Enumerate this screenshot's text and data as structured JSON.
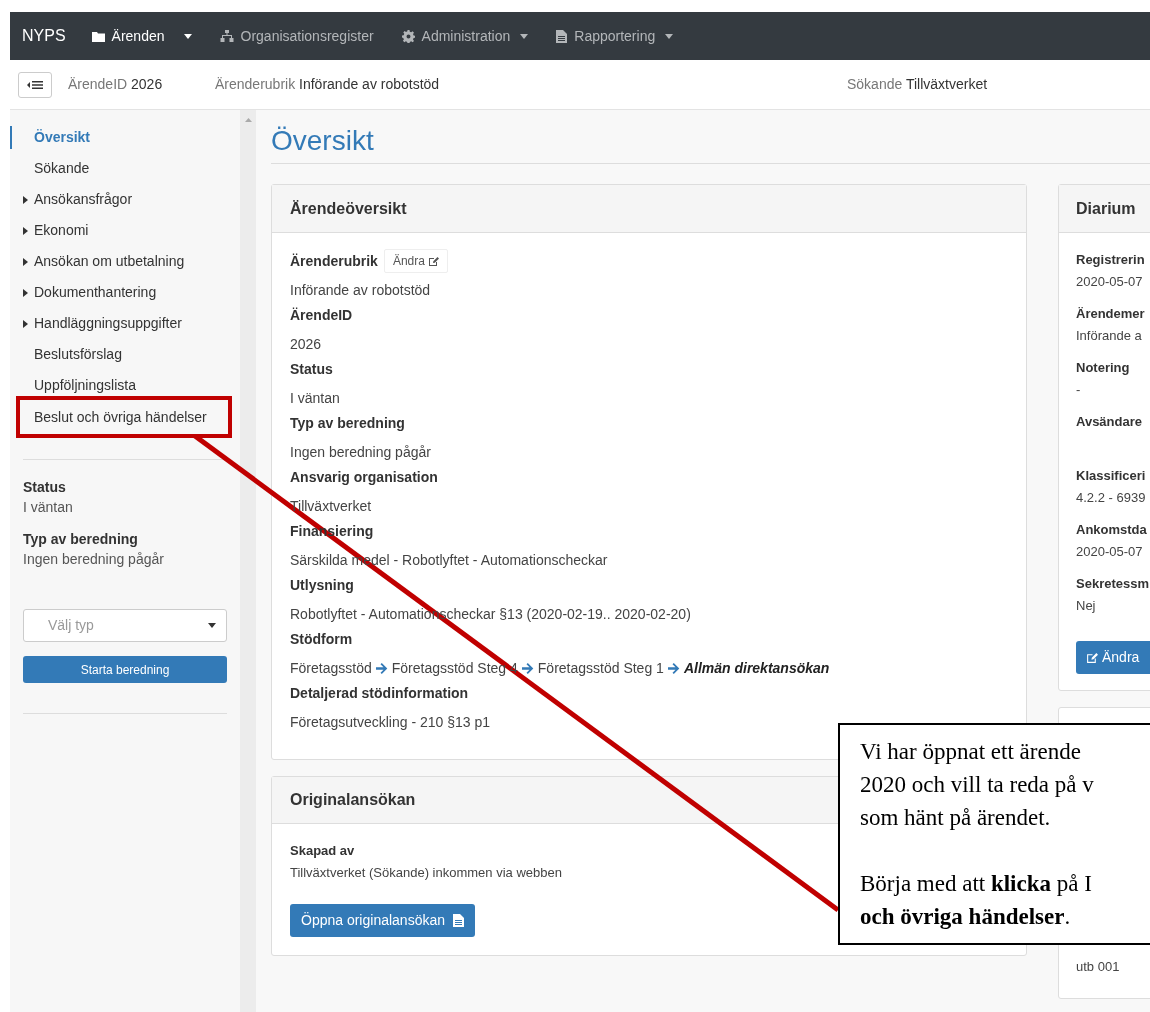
{
  "navbar": {
    "brand": "NYPS",
    "items": [
      {
        "label": "Ärenden",
        "dropdown": true,
        "active": true
      },
      {
        "label": "Organisationsregister",
        "dropdown": false,
        "active": false
      },
      {
        "label": "Administration",
        "dropdown": true,
        "active": false
      },
      {
        "label": "Rapportering",
        "dropdown": true,
        "active": false
      }
    ]
  },
  "case_header": [
    {
      "label": "ÄrendeID",
      "value": "2026"
    },
    {
      "label": "Ärenderubrik",
      "value": "Införande av robotstöd"
    },
    {
      "label": "Sökande",
      "value": "Tillväxtverket"
    }
  ],
  "sidebar": {
    "items": [
      {
        "label": "Översikt",
        "expandable": false,
        "selected": true,
        "highlighted": false
      },
      {
        "label": "Sökande",
        "expandable": false,
        "selected": false,
        "highlighted": false
      },
      {
        "label": "Ansökansfrågor",
        "expandable": true,
        "selected": false,
        "highlighted": false
      },
      {
        "label": "Ekonomi",
        "expandable": true,
        "selected": false,
        "highlighted": false
      },
      {
        "label": "Ansökan om utbetalning",
        "expandable": true,
        "selected": false,
        "highlighted": false
      },
      {
        "label": "Dokumenthantering",
        "expandable": true,
        "selected": false,
        "highlighted": false
      },
      {
        "label": "Handläggningsuppgifter",
        "expandable": true,
        "selected": false,
        "highlighted": false
      },
      {
        "label": "Beslutsförslag",
        "expandable": false,
        "selected": false,
        "highlighted": false
      },
      {
        "label": "Uppföljningslista",
        "expandable": false,
        "selected": false,
        "highlighted": false
      },
      {
        "label": "Beslut och övriga händelser",
        "expandable": false,
        "selected": false,
        "highlighted": true
      }
    ],
    "summary": [
      {
        "label": "Status",
        "value": "I väntan"
      },
      {
        "label": "Typ av beredning",
        "value": "Ingen beredning pågår"
      }
    ],
    "type_select": {
      "placeholder": "Välj typ"
    },
    "start_button": "Starta beredning"
  },
  "page_title": "Översikt",
  "overview_card": {
    "title": "Ärendeöversikt",
    "edit_button": "Ändra",
    "fields": [
      {
        "label": "Ärenderubrik",
        "value": "Införande av robotstöd",
        "editable": true
      },
      {
        "label": "ÄrendeID",
        "value": "2026",
        "editable": false
      },
      {
        "label": "Status",
        "value": "I väntan",
        "editable": false
      },
      {
        "label": "Typ av beredning",
        "value": "Ingen beredning pågår",
        "editable": false
      },
      {
        "label": "Ansvarig organisation",
        "value": "Tillväxtverket",
        "editable": false
      },
      {
        "label": "Finansiering",
        "value": "Särskilda medel - Robotlyftet - Automationscheckar",
        "editable": false
      },
      {
        "label": "Utlysning",
        "value": "Robotlyftet - Automationscheckar §13 (2020-02-19.. 2020-02-20)",
        "editable": false
      }
    ],
    "support_form": {
      "label": "Stödform",
      "steps": [
        {
          "text": "Företagsstöd",
          "emphasis": false
        },
        {
          "text": "Företagsstöd Steg 4",
          "emphasis": false
        },
        {
          "text": "Företagsstöd Steg 1",
          "emphasis": false
        },
        {
          "text": "Allmän direktansökan",
          "emphasis": true
        }
      ]
    },
    "detail": {
      "label": "Detaljerad stödinformation",
      "value": "Företagsutveckling - 210 §13 p1"
    }
  },
  "original_card": {
    "title": "Originalansökan",
    "label": "Skapad av",
    "value": "Tillväxtverket (Sökande) inkommen via webben",
    "button": "Öppna originalansökan"
  },
  "diarium_card": {
    "title": "Diarium",
    "fields": [
      {
        "label": "Registrerin",
        "value": "2020-05-07"
      },
      {
        "label": "Ärendemer",
        "value": "Införande a"
      },
      {
        "label": "Notering",
        "value": "-"
      },
      {
        "label": "Avsändare"
      },
      {
        "label": "Klassificeri",
        "value": "4.2.2 - 6939"
      },
      {
        "label": "Ankomstda",
        "value": "2020-05-07"
      },
      {
        "label": "Sekretessm",
        "value": "Nej"
      }
    ],
    "button": "Ändra"
  },
  "lower_right_card": {
    "value": "utb 001"
  },
  "callout": {
    "paragraphs": [
      [
        "Vi har öppnat ett ärende",
        "2020 och vill ta reda på v",
        "som hänt på ärendet."
      ],
      [
        "Börja med att **klicka** på I",
        "**och övriga händelser**."
      ]
    ]
  }
}
